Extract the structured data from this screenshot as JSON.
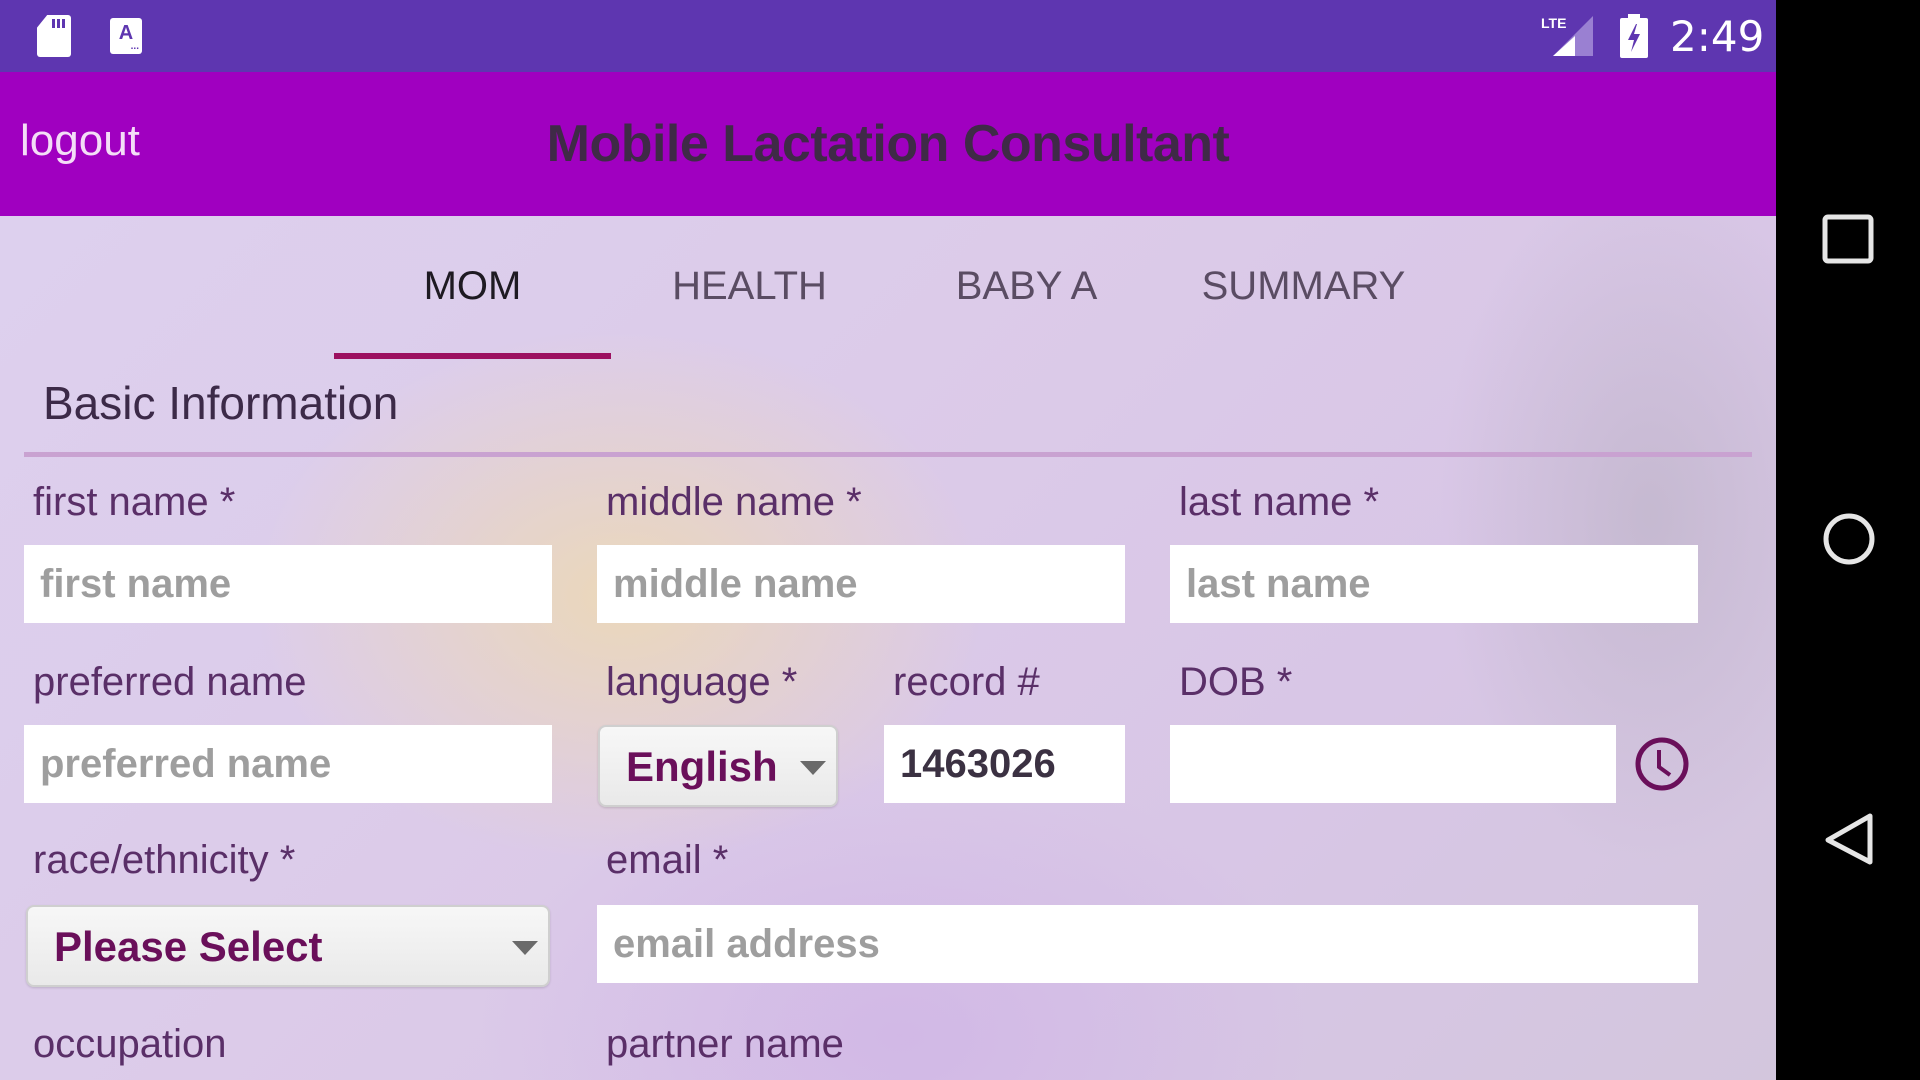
{
  "status_bar": {
    "icons": [
      "sd-card-icon",
      "accessibility-icon",
      "lte-signal-icon",
      "battery-charging-icon"
    ],
    "accessibility_glyph": "A",
    "network_label": "LTE",
    "time": "2:49"
  },
  "app_bar": {
    "logout_label": "logout",
    "title": "Mobile Lactation Consultant",
    "color": "#A000C0"
  },
  "tabs": {
    "items": [
      {
        "label": "MOM",
        "active": true
      },
      {
        "label": "HEALTH",
        "active": false
      },
      {
        "label": "BABY A",
        "active": false
      },
      {
        "label": "SUMMARY",
        "active": false
      }
    ],
    "indicator_color": "#9C1060"
  },
  "section": {
    "title": "Basic Information"
  },
  "form": {
    "first_name": {
      "label": "first name *",
      "placeholder": "first name",
      "value": ""
    },
    "middle_name": {
      "label": "middle name *",
      "placeholder": "middle name",
      "value": ""
    },
    "last_name": {
      "label": "last name *",
      "placeholder": "last name",
      "value": ""
    },
    "preferred_name": {
      "label": "preferred name",
      "placeholder": "preferred name",
      "value": ""
    },
    "language": {
      "label": "language *",
      "selected": "English"
    },
    "record": {
      "label": "record #",
      "value": "1463026"
    },
    "dob": {
      "label": "DOB *",
      "value": "",
      "icon": "clock-icon"
    },
    "race": {
      "label": "race/ethnicity *",
      "selected": "Please Select"
    },
    "email": {
      "label": "email *",
      "placeholder": "email address",
      "value": ""
    },
    "occupation": {
      "label": "occupation"
    },
    "partner_name": {
      "label": "partner name"
    }
  },
  "nav_bar": {
    "buttons": [
      "recents-button",
      "home-button",
      "back-button"
    ]
  }
}
